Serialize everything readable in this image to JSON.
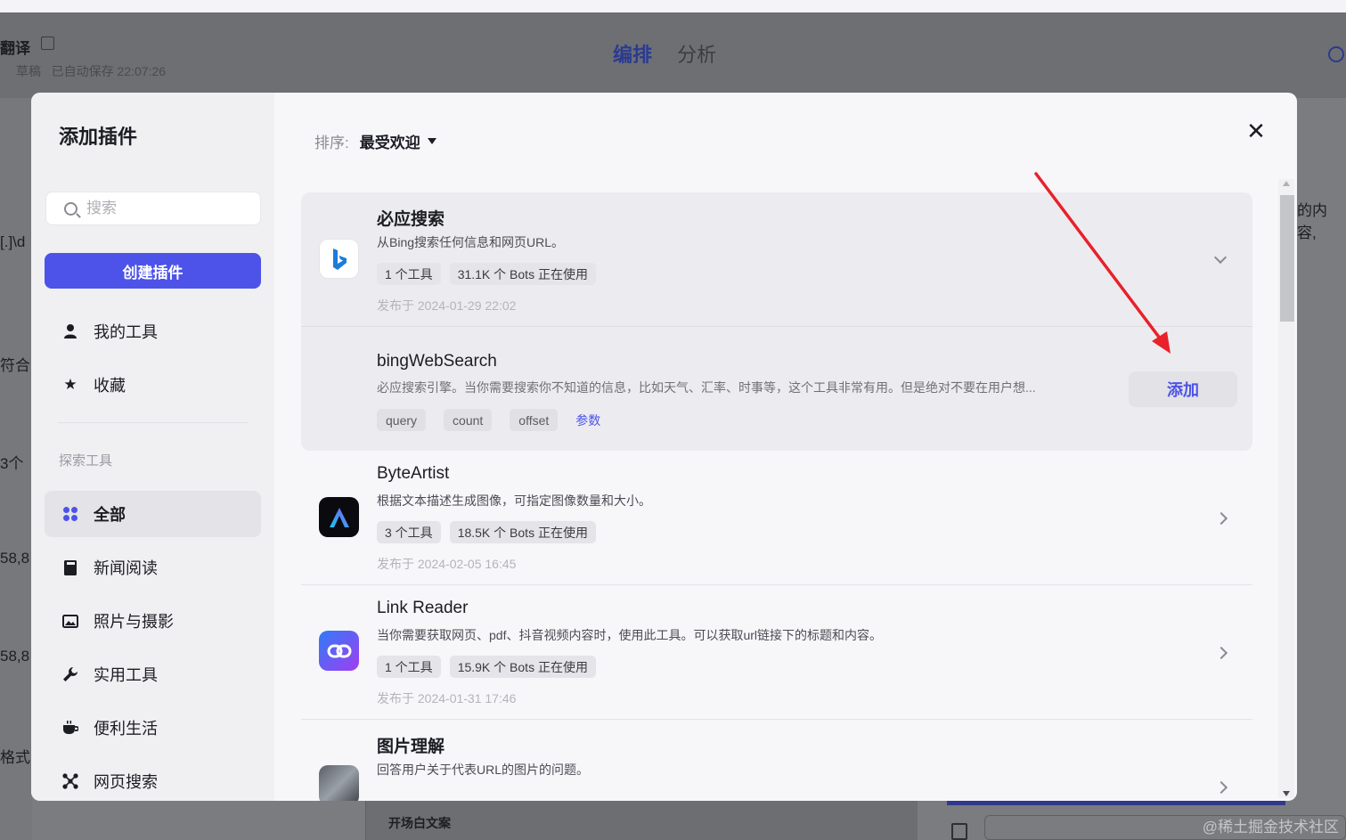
{
  "background": {
    "title": "翻译",
    "status": "草稿",
    "autosave": "已自动保存 22:07:26",
    "tabs": [
      "编排",
      "分析"
    ],
    "edge_texts": [
      "[.]\\d",
      "符合i",
      "3个",
      "58,8",
      "58,8",
      "格式"
    ],
    "right_text": "的内容,",
    "bottom_text": "开场白文案",
    "watermark": "@稀土掘金技术社区"
  },
  "modal": {
    "title": "添加插件",
    "search_placeholder": "搜索",
    "create_button": "创建插件",
    "nav": [
      {
        "label": "我的工具",
        "icon": "user-icon"
      },
      {
        "label": "收藏",
        "icon": "star-icon"
      }
    ],
    "section_label": "探索工具",
    "categories": [
      {
        "label": "全部",
        "icon": "grid-icon",
        "active": true
      },
      {
        "label": "新闻阅读",
        "icon": "book-icon",
        "active": false
      },
      {
        "label": "照片与摄影",
        "icon": "image-icon",
        "active": false
      },
      {
        "label": "实用工具",
        "icon": "wrench-icon",
        "active": false
      },
      {
        "label": "便利生活",
        "icon": "cup-icon",
        "active": false
      },
      {
        "label": "网页搜索",
        "icon": "network-icon",
        "active": false
      }
    ],
    "sort_label": "排序:",
    "sort_value": "最受欢迎",
    "plugins": [
      {
        "name": "必应搜索",
        "desc": "从Bing搜索任何信息和网页URL。",
        "tools": "1 个工具",
        "bots": "31.1K 个 Bots 正在使用",
        "date": "发布于 2024-01-29 22:02",
        "expanded": true,
        "tool": {
          "name": "bingWebSearch",
          "desc": "必应搜索引擎。当你需要搜索你不知道的信息，比如天气、汇率、时事等，这个工具非常有用。但是绝对不要在用户想...",
          "params": [
            "query",
            "count",
            "offset"
          ],
          "params_link": "参数",
          "add_label": "添加"
        }
      },
      {
        "name": "ByteArtist",
        "desc": "根据文本描述生成图像，可指定图像数量和大小。",
        "tools": "3 个工具",
        "bots": "18.5K 个 Bots 正在使用",
        "date": "发布于 2024-02-05 16:45",
        "expanded": false
      },
      {
        "name": "Link Reader",
        "desc": "当你需要获取网页、pdf、抖音视频内容时，使用此工具。可以获取url链接下的标题和内容。",
        "tools": "1 个工具",
        "bots": "15.9K 个 Bots 正在使用",
        "date": "发布于 2024-01-31 17:46",
        "expanded": false
      },
      {
        "name": "图片理解",
        "desc": "回答用户关于代表URL的图片的问题。",
        "expanded": false
      }
    ]
  },
  "colors": {
    "accent": "#4d53e8",
    "arrow": "#e8212b"
  }
}
